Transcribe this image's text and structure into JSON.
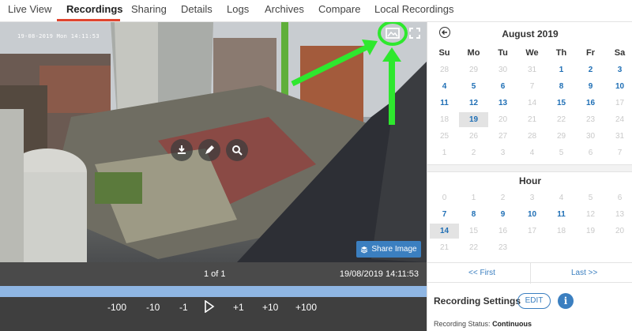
{
  "nav": {
    "tabs": [
      {
        "label": "Live View"
      },
      {
        "label": "Recordings"
      },
      {
        "label": "Sharing"
      },
      {
        "label": "Details"
      },
      {
        "label": "Logs"
      },
      {
        "label": "Archives"
      },
      {
        "label": "Compare"
      },
      {
        "label": "Local Recordings"
      }
    ],
    "active": "Recordings",
    "accent_color": "#e0452f"
  },
  "viewer": {
    "overlay_timestamp": "19-08-2019 Mon 14:11:53",
    "icons": [
      "gallery-icon",
      "fullscreen-icon",
      "download-icon",
      "edit-icon",
      "search-icon"
    ],
    "share_button_label": "Share Image",
    "annotation_color": "#2ee82e"
  },
  "infobar": {
    "count": "1 of 1",
    "timestamp": "19/08/2019 14:11:53"
  },
  "playback": {
    "steps": [
      "-100",
      "-10",
      "-1",
      "+1",
      "+10",
      "+100"
    ]
  },
  "calendar": {
    "month": "August 2019",
    "weekdays": [
      "Su",
      "Mo",
      "Tu",
      "We",
      "Th",
      "Fr",
      "Sa"
    ],
    "rows": [
      [
        {
          "d": "28",
          "s": "muted"
        },
        {
          "d": "29",
          "s": "muted"
        },
        {
          "d": "30",
          "s": "muted"
        },
        {
          "d": "31",
          "s": "muted"
        },
        {
          "d": "1",
          "s": "avail"
        },
        {
          "d": "2",
          "s": "avail"
        },
        {
          "d": "3",
          "s": "avail"
        }
      ],
      [
        {
          "d": "4",
          "s": "avail"
        },
        {
          "d": "5",
          "s": "avail"
        },
        {
          "d": "6",
          "s": "avail"
        },
        {
          "d": "7",
          "s": "muted"
        },
        {
          "d": "8",
          "s": "avail"
        },
        {
          "d": "9",
          "s": "avail"
        },
        {
          "d": "10",
          "s": "avail"
        }
      ],
      [
        {
          "d": "11",
          "s": "avail"
        },
        {
          "d": "12",
          "s": "avail"
        },
        {
          "d": "13",
          "s": "avail"
        },
        {
          "d": "14",
          "s": "muted"
        },
        {
          "d": "15",
          "s": "avail"
        },
        {
          "d": "16",
          "s": "avail"
        },
        {
          "d": "17",
          "s": "muted"
        }
      ],
      [
        {
          "d": "18",
          "s": "muted"
        },
        {
          "d": "19",
          "s": "sel"
        },
        {
          "d": "20",
          "s": "muted"
        },
        {
          "d": "21",
          "s": "muted"
        },
        {
          "d": "22",
          "s": "muted"
        },
        {
          "d": "23",
          "s": "muted"
        },
        {
          "d": "24",
          "s": "muted"
        }
      ],
      [
        {
          "d": "25",
          "s": "muted"
        },
        {
          "d": "26",
          "s": "muted"
        },
        {
          "d": "27",
          "s": "muted"
        },
        {
          "d": "28",
          "s": "muted"
        },
        {
          "d": "29",
          "s": "muted"
        },
        {
          "d": "30",
          "s": "muted"
        },
        {
          "d": "31",
          "s": "muted"
        }
      ],
      [
        {
          "d": "1",
          "s": "muted"
        },
        {
          "d": "2",
          "s": "muted"
        },
        {
          "d": "3",
          "s": "muted"
        },
        {
          "d": "4",
          "s": "muted"
        },
        {
          "d": "5",
          "s": "muted"
        },
        {
          "d": "6",
          "s": "muted"
        },
        {
          "d": "7",
          "s": "muted"
        }
      ]
    ]
  },
  "hours": {
    "title": "Hour",
    "rows": [
      [
        {
          "d": "0",
          "s": "muted"
        },
        {
          "d": "1",
          "s": "muted"
        },
        {
          "d": "2",
          "s": "muted"
        },
        {
          "d": "3",
          "s": "muted"
        },
        {
          "d": "4",
          "s": "muted"
        },
        {
          "d": "5",
          "s": "muted"
        },
        {
          "d": "6",
          "s": "muted"
        }
      ],
      [
        {
          "d": "7",
          "s": "avail"
        },
        {
          "d": "8",
          "s": "avail"
        },
        {
          "d": "9",
          "s": "avail"
        },
        {
          "d": "10",
          "s": "avail"
        },
        {
          "d": "11",
          "s": "avail"
        },
        {
          "d": "12",
          "s": "muted"
        },
        {
          "d": "13",
          "s": "muted"
        }
      ],
      [
        {
          "d": "14",
          "s": "sel"
        },
        {
          "d": "15",
          "s": "muted"
        },
        {
          "d": "16",
          "s": "muted"
        },
        {
          "d": "17",
          "s": "muted"
        },
        {
          "d": "18",
          "s": "muted"
        },
        {
          "d": "19",
          "s": "muted"
        },
        {
          "d": "20",
          "s": "muted"
        }
      ],
      [
        {
          "d": "21",
          "s": "muted"
        },
        {
          "d": "22",
          "s": "muted"
        },
        {
          "d": "23",
          "s": "muted"
        }
      ]
    ]
  },
  "pager": {
    "first": "<< First",
    "last": "Last >>"
  },
  "recording_settings": {
    "title": "Recording Settings",
    "edit_label": "EDIT",
    "info_label": "i",
    "status_label": "Recording Status:",
    "status_value": "Continuous"
  }
}
